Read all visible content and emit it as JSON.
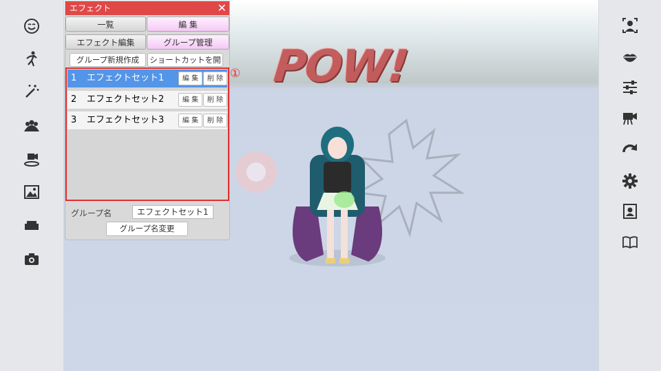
{
  "panel": {
    "title": "エフェクト",
    "tabs": {
      "list": "一覧",
      "edit": "編 集",
      "effect_edit": "エフェクト編集",
      "group_manage": "グループ管理"
    },
    "buttons": {
      "new_group": "グループ新規作成",
      "open_shortcut": "ショートカットを開く"
    },
    "rows": [
      {
        "num": "1",
        "name": "エフェクトセット1",
        "edit": "編 集",
        "del": "削 除",
        "selected": true
      },
      {
        "num": "2",
        "name": "エフェクトセット2",
        "edit": "編 集",
        "del": "削 除",
        "selected": false
      },
      {
        "num": "3",
        "name": "エフェクトセット3",
        "edit": "編 集",
        "del": "削 除",
        "selected": false
      }
    ],
    "group_name_label": "グループ名",
    "group_name_value": "エフェクトセット1",
    "rename_button": "グループ名変更"
  },
  "annotation": "①",
  "scene": {
    "pow_text": "POW!"
  },
  "left_icons": [
    "face-icon",
    "pose-icon",
    "magic-wand-icon",
    "group-icon",
    "camera-stage-icon",
    "image-icon",
    "sofa-icon",
    "camera-icon"
  ],
  "right_icons": [
    "face-frame-icon",
    "lips-icon",
    "sliders-icon",
    "video-camera-icon",
    "redo-icon",
    "settings-gear-icon",
    "portrait-icon",
    "book-icon"
  ],
  "colors": {
    "title_red": "#e04848",
    "selection_blue": "#5395e8",
    "highlight_red": "#e03030",
    "pink_tab": "#f4c9f4"
  }
}
